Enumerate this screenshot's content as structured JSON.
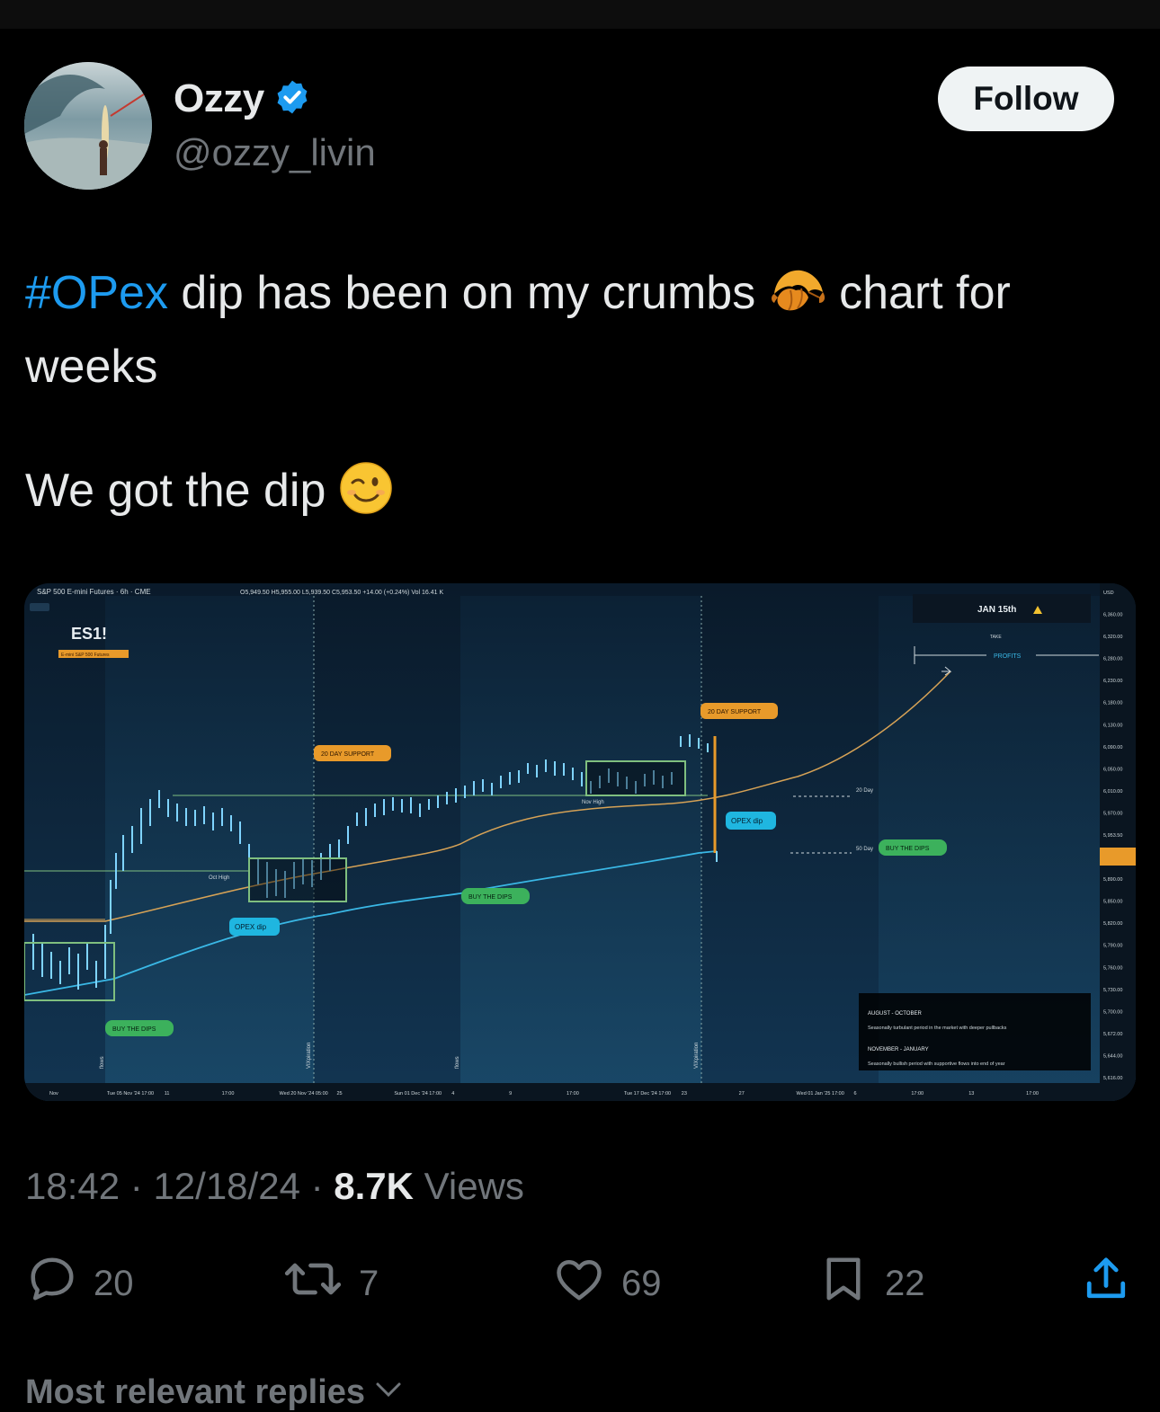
{
  "author": {
    "name": "Ozzy",
    "handle": "@ozzy_livin",
    "verified": true
  },
  "follow_label": "Follow",
  "tweet": {
    "hashtag": "#OPex",
    "line1_rest": " dip has been on my crumbs ",
    "line1_end": " chart for",
    "line2": "weeks",
    "line3": "We got the dip "
  },
  "chart": {
    "header": "S&P 500 E-mini Futures · 6h · CME",
    "ohlc": "O5,949.50 H5,955.00 L5,939.50 C5,953.50 +14.00 (+0.24%) Vol 16.41 K",
    "symbol": "ES1!",
    "symbol_sub": "E-mini S&P 500 Futures",
    "annotations": {
      "jan15": "JAN 15th",
      "take": "TAKE",
      "profits": "PROFITS",
      "support_1": "20 DAY SUPPORT",
      "support_2": "20 DAY SUPPORT",
      "opex_dip_1": "OPEX dip",
      "opex_dip_2": "OPEX dip",
      "buy_dips_1": "BUY THE DIPS",
      "buy_dips_2": "BUY THE DIPS",
      "buy_dips_3": "BUY THE DIPS",
      "oct_high": "Oct High",
      "nov_high": "Nov High",
      "day20": "20 Day",
      "day50": "50 Day",
      "flows_1": "flows",
      "flows_2": "flows",
      "vix_1": "VIXpiration",
      "vix_2": "VIXpiration"
    },
    "seasonal": {
      "h1": "AUGUST - OCTOBER",
      "t1": "Seasonally turbulant period in the market with deeper pullbacks",
      "h2": "NOVEMBER - JANUARY",
      "t2": "Seasonally bullish period with supportive flows into end of year"
    },
    "price_axis": [
      "USD",
      "6,360.00",
      "6,320.00",
      "6,280.00",
      "6,230.00",
      "6,180.00",
      "6,130.00",
      "6,090.00",
      "6,050.00",
      "6,010.00",
      "5,970.00",
      "5,953.50",
      "05:28:18",
      "5,890.00",
      "5,850.00",
      "5,820.00",
      "5,790.00",
      "5,760.00",
      "5,730.00",
      "5,700.00",
      "5,672.00",
      "5,644.00",
      "5,616.00"
    ],
    "time_axis": [
      "Nov",
      "Tue 05 Nov '24  17:00",
      "11",
      "17:00",
      "Wed 20 Nov '24  05:00",
      "25",
      "Sun 01 Dec '24  17:00",
      "4",
      "9",
      "17:00",
      "Tue 17 Dec '24  17:00",
      "23",
      "27",
      "Wed 01 Jan '25  17:00",
      "6",
      "17:00",
      "13",
      "17:00"
    ]
  },
  "meta": {
    "time": "18:42",
    "sep1": " · ",
    "date": "12/18/24",
    "sep2": " · ",
    "views_count": "8.7K",
    "views_label": " Views"
  },
  "actions": {
    "replies": "20",
    "reposts": "7",
    "likes": "69",
    "bookmarks": "22"
  },
  "replies_sort": "Most relevant replies"
}
